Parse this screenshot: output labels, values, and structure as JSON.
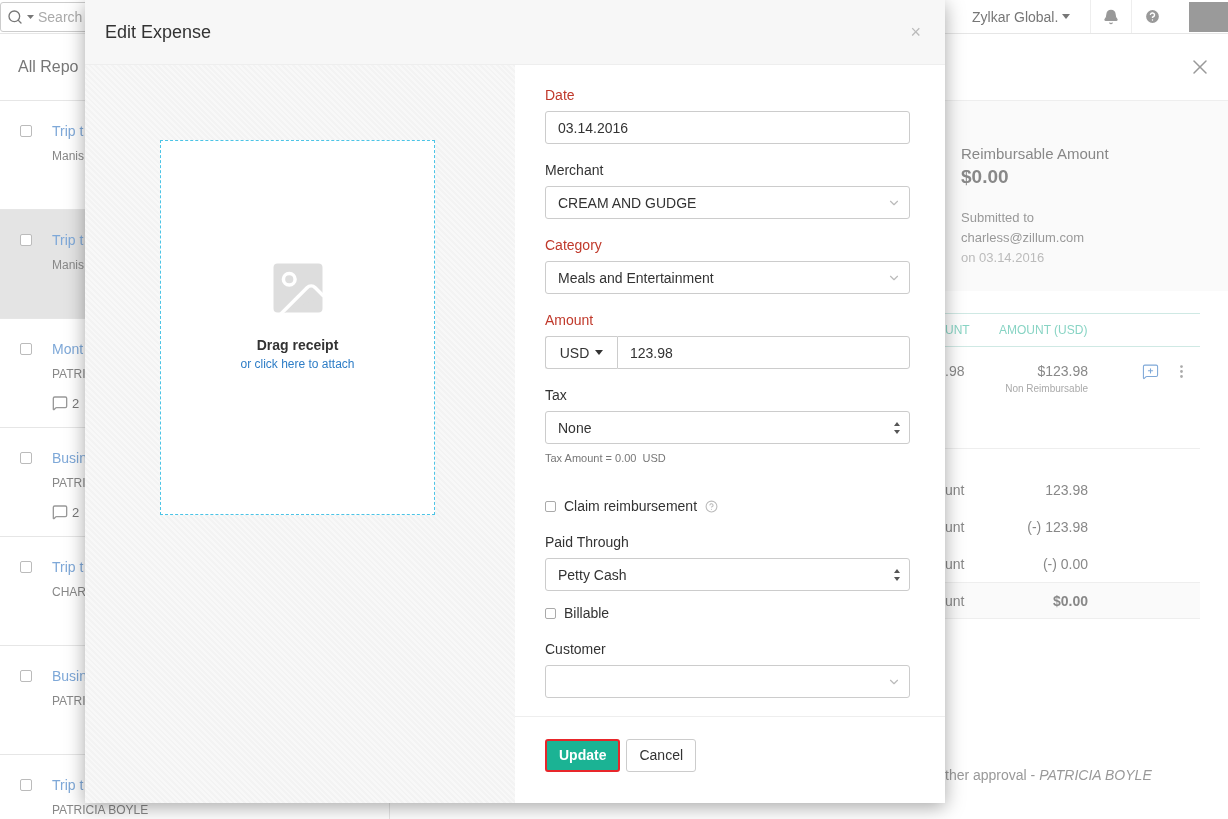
{
  "top_bar": {
    "search": {
      "placeholder": "Search"
    },
    "organization": "Zylkar Global."
  },
  "reports_list": {
    "title": "All Repo",
    "items": [
      {
        "title": "Trip t",
        "subtitle": "Manis",
        "selected": false
      },
      {
        "title": "Trip t",
        "subtitle": "Manis",
        "selected": true
      },
      {
        "title": "Mont",
        "subtitle": "PATRI",
        "comments": "2",
        "selected": false
      },
      {
        "title": "Busin",
        "subtitle": "PATRI",
        "comments": "2",
        "selected": false
      },
      {
        "title": "Trip t",
        "subtitle": "CHAR",
        "selected": false
      },
      {
        "title": "Busin",
        "subtitle": "PATRI",
        "selected": false
      },
      {
        "title": "Trip t",
        "subtitle": "PATRICIA BOYLE",
        "selected": false
      }
    ]
  },
  "report_detail": {
    "summary": {
      "label": "Reimbursable Amount",
      "amount": "$0.00",
      "submitted_label": "Submitted to",
      "submitted_to": "charless@zillum.com",
      "submitted_on": "on 03.14.2016"
    },
    "table": {
      "columns": [
        "UNT",
        "AMOUNT (USD)"
      ],
      "rows": [
        {
          "column_1": ".98",
          "amount": "$123.98",
          "note": "Non Reimbursable"
        }
      ]
    },
    "totals": [
      {
        "label": "unt",
        "value": "123.98",
        "bold": false
      },
      {
        "label": "unt",
        "value": "(-) 123.98",
        "bold": false
      },
      {
        "label": "unt",
        "value": "(-) 0.00",
        "bold": false
      },
      {
        "label": "unt",
        "value": "$0.00",
        "bold": true
      }
    ],
    "activity": [
      "ther approval - *PATRICIA BOYLE*"
    ]
  },
  "dialog": {
    "title": "Edit Expense",
    "close": "×",
    "receipt": {
      "title": "Drag receipt",
      "link": "or click here to attach"
    },
    "fields": [
      {
        "kind": "text",
        "label": "Date",
        "required": true,
        "value": "03.14.2016"
      },
      {
        "kind": "dropdown",
        "label": "Merchant",
        "required": false,
        "value": "CREAM AND GUDGE"
      },
      {
        "kind": "dropdown",
        "label": "Category",
        "required": true,
        "value": "Meals and Entertainment"
      },
      {
        "kind": "currency",
        "label": "Amount",
        "required": true,
        "currency": "USD",
        "value": "123.98"
      },
      {
        "kind": "select",
        "label": "Tax",
        "required": false,
        "value": "None",
        "hint": "Tax Amount = 0.00  USD"
      },
      {
        "kind": "checkbox",
        "label": "Claim reimbursement",
        "checked": false,
        "help": true
      },
      {
        "kind": "select",
        "label": "Paid Through",
        "required": false,
        "value": "Petty Cash"
      },
      {
        "kind": "checkbox",
        "label": "Billable",
        "checked": false,
        "help": false
      },
      {
        "kind": "dropdown",
        "label": "Customer",
        "required": false
      }
    ],
    "buttons": [
      {
        "kind": "primary",
        "label": "Update"
      },
      {
        "kind": "secondary",
        "label": "Cancel"
      }
    ]
  }
}
